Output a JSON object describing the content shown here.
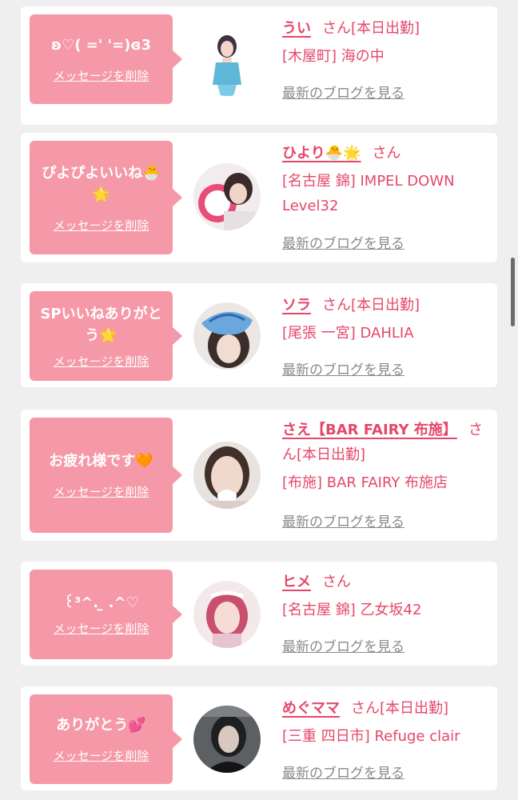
{
  "delete_label": "メッセージを削除",
  "honorific": "さん",
  "blog_label": "最新のブログを見る",
  "colors": {
    "page_background": "#efefef",
    "card_background": "#ffffff",
    "bubble_pink": "#f598a7",
    "name_pink": "#e5476a",
    "link_gray": "#8a8a8a"
  },
  "messages": [
    {
      "message": "ʚ♡( =' '=)ɞ3",
      "name": "うい",
      "status": "[本日出勤]",
      "location": "[木屋町] 海の中"
    },
    {
      "message": "ぴよぴよいいね🐣🌟",
      "name": "ひより🐣🌟",
      "status": "",
      "location": "[名古屋 錦] IMPEL DOWN Level32"
    },
    {
      "message": "SPいいねありがとう🌟",
      "name": "ソラ",
      "status": "[本日出勤]",
      "location": "[尾張 一宮] DAHLIA"
    },
    {
      "message": "お疲れ様です🧡",
      "name": "さえ【BAR FAIRY 布施】",
      "status": "[本日出勤]",
      "location": "[布施] BAR FAIRY 布施店"
    },
    {
      "message": "꒰³^. ̫ .^♡",
      "name": "ヒメ",
      "status": "",
      "location": "[名古屋 錦] 乙女坂42"
    },
    {
      "message": "ありがとう💕",
      "name": "めぐママ",
      "status": "[本日出勤]",
      "location": "[三重 四日市] Refuge clair"
    }
  ]
}
